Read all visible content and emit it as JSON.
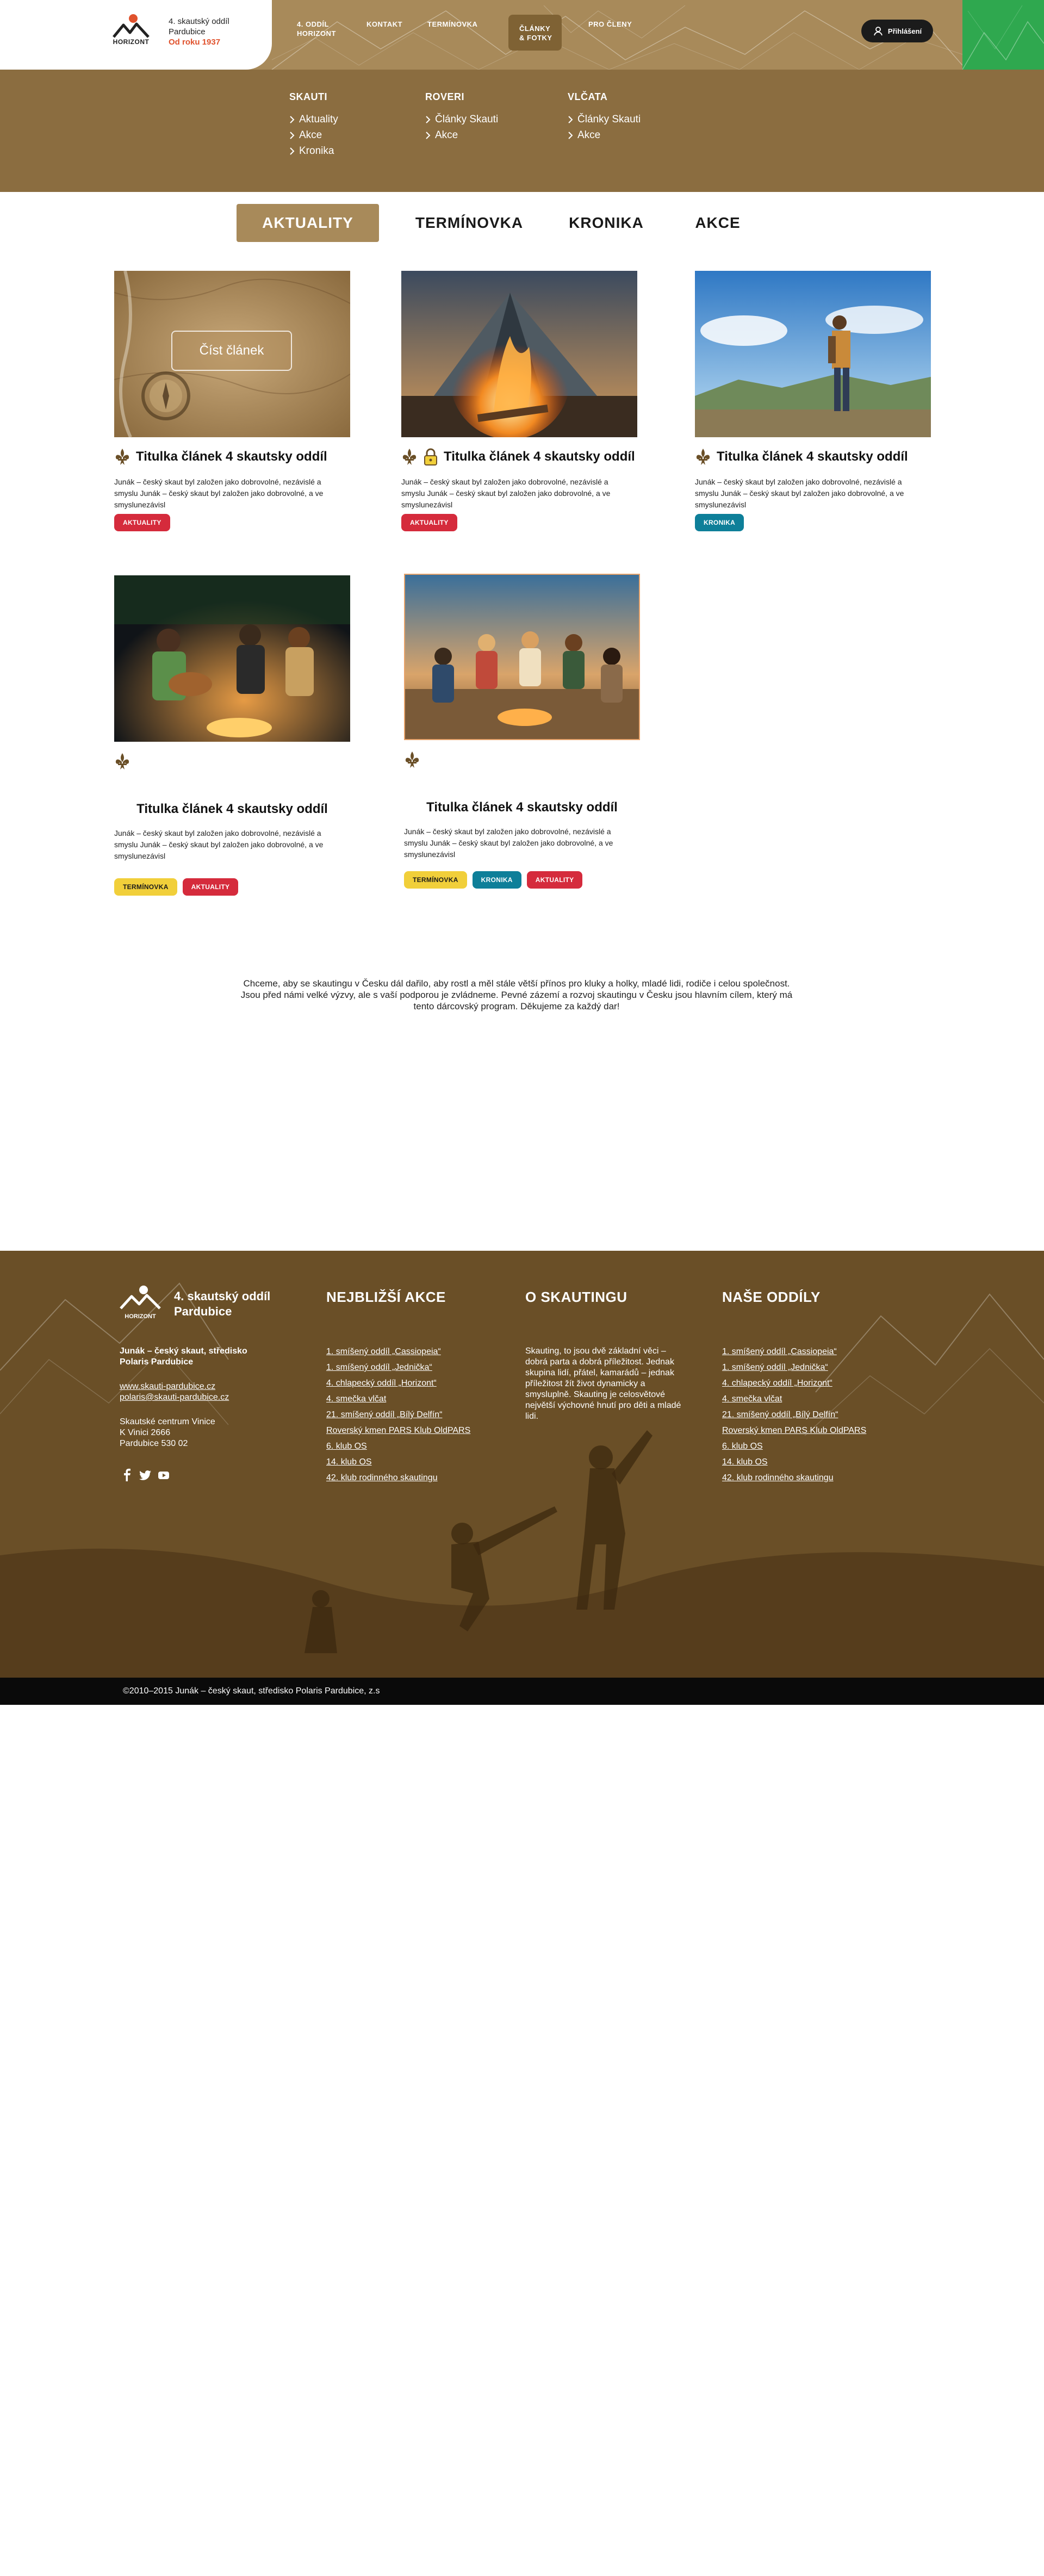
{
  "header": {
    "logo_text": "HORIZONT",
    "org_line1": "4. skautský oddíl",
    "org_line2": "Pardubice",
    "org_since": "Od roku 1937",
    "nav": [
      {
        "label": "4. ODDÍL",
        "label2": "HORIZONT"
      },
      {
        "label": "KONTAKT",
        "label2": ""
      },
      {
        "label": "TERMÍNOVKA",
        "label2": ""
      },
      {
        "label": "ČLÁNKY",
        "label2": "& FOTKY"
      },
      {
        "label": "PRO ČLENY",
        "label2": ""
      }
    ],
    "login_label": "Přihlášení"
  },
  "mega_menu": {
    "columns": [
      {
        "heading": "SKAUTI",
        "links": [
          "Aktuality",
          "Akce",
          "Kronika"
        ]
      },
      {
        "heading": "ROVERI",
        "links": [
          "Články Skauti",
          "Akce"
        ]
      },
      {
        "heading": "VLČATA",
        "links": [
          "Články Skauti",
          "Akce"
        ]
      }
    ]
  },
  "tabs": [
    "AKTUALITY",
    "TERMÍNOVKA",
    "KRONIKA",
    "AKCE"
  ],
  "cards": [
    {
      "title": "Titulka článek 4 skautsky oddíl",
      "text": "Junák – český skaut byl založen jako dobrovolné, nezávislé a smyslu Junák – český skaut byl založen jako dobrovolné, a ve smyslunezávisl",
      "badges": [
        "AKTUALITY"
      ],
      "read_label": "Číst článek",
      "image": "compass-map"
    },
    {
      "title": "Titulka článek 4 skautsky oddíl",
      "text": "Junák – český skaut byl založen jako dobrovolné, nezávislé a smyslu Junák – český skaut byl založen jako dobrovolné, a ve smyslunezávisl",
      "badges": [
        "AKTUALITY"
      ],
      "image": "campfire-tent"
    },
    {
      "title": "Titulka článek 4 skautsky oddíl",
      "text": "Junák – český skaut byl založen jako dobrovolné, nezávislé a smyslu Junák – český skaut byl založen jako dobrovolné, a ve smyslunezávisl",
      "badges": [
        "KRONIKA"
      ],
      "image": "hiker"
    },
    {
      "title": "Titulka článek 4 skautsky oddíl",
      "text": "Junák – český skaut byl založen jako dobrovolné, nezávislé a smyslu Junák – český skaut byl založen jako dobrovolné, a ve smyslunezávisl",
      "badges": [
        "TERMÍNOVKA",
        "AKTUALITY"
      ],
      "image": "guitar-campfire"
    },
    {
      "title": "Titulka článek 4 skautsky oddíl",
      "text": "Junák – český skaut byl založen jako dobrovolné, nezávislé a smyslu Junák – český skaut byl založen jako dobrovolné, a ve smyslunezávisl",
      "badges": [
        "TERMÍNOVKA",
        "KRONIKA",
        "AKTUALITY"
      ],
      "image": "friends-campfire"
    }
  ],
  "mission_text": "Chceme, aby se skautingu v Česku dál dařilo, aby rostl a měl stále větší přínos pro kluky a holky, mladé lidi, rodiče i celou společnost. Jsou před námi velké výzvy, ale s vaší podporou je zvládneme. Pevné zázemí a rozvoj skautingu v Česku jsou hlavním cílem, který má tento dárcovský program. Děkujeme za každý dar!",
  "footer": {
    "logo_text": "HORIZONT",
    "org_line1": "4. skautský oddíl",
    "org_line2": "Pardubice",
    "parent_line1": "Junák – český skaut, středisko",
    "parent_line2": "Polaris Pardubice",
    "web": "www.skauti-pardubice.cz",
    "email": "polaris@skauti-pardubice.cz",
    "address": [
      "Skautské centrum Vinice",
      "K Vinici 2666",
      "Pardubice 530 02"
    ],
    "events_heading": "NEJBLIŽŠÍ AKCE",
    "events": [
      "1. smíšený oddíl „Cassiopeia“",
      "1. smíšený oddíl „Jednička“",
      "4. chlapecký oddíl „Horizont“",
      "4. smečka vlčat",
      "21. smíšený oddíl „Bílý Delfín“",
      "Roverský kmen PARS Klub OldPARS",
      "6. klub OS",
      "14. klub OS",
      "42. klub rodinného skautingu"
    ],
    "about_heading": "O SKAUTINGU",
    "about_text": "Skauting, to jsou dvě základní věci – dobrá parta a dobrá příležitost. Jednak skupina lidí, přátel, kamarádů – jednak příležitost žít život dynamicky a smysluplně. Skauting je celosvětové největší výchovné hnutí pro děti a mladé lidi.",
    "units_heading": "NAŠE ODDÍLY",
    "units": [
      "1. smíšený oddíl „Cassiopeia“",
      "1. smíšený oddíl „Jednička“",
      "4. chlapecký oddíl „Horizont“",
      "4. smečka vlčat",
      "21. smíšený oddíl „Bílý Delfín“",
      "Roverský kmen PARS Klub OldPARS",
      "6. klub OS",
      "14. klub OS",
      "42. klub rodinného skautingu"
    ],
    "copyright": "©2010–2015 Junák – český skaut, středisko Polaris Pardubice, z.s"
  },
  "colors": {
    "brand": "#a88a5a",
    "menu": "#8b6d40",
    "footer": "#6a4f27",
    "red": "#d52b3c",
    "teal": "#0e7f99",
    "yellow": "#f1cf3a",
    "accent_orange": "#e0522d",
    "green": "#2fa84f"
  }
}
